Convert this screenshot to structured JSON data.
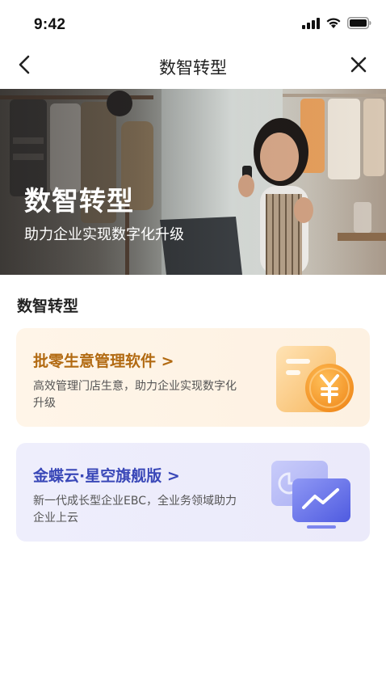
{
  "status_bar": {
    "time": "9:42",
    "icons": [
      "signal-icon",
      "wifi-icon",
      "battery-icon"
    ]
  },
  "nav": {
    "title": "数智转型",
    "back_icon": "chevron-left-icon",
    "close_icon": "close-icon"
  },
  "hero": {
    "title": "数智转型",
    "subtitle": "助力企业实现数字化升级"
  },
  "section": {
    "title": "数智转型"
  },
  "cards": [
    {
      "title": "批零生意管理软件 >",
      "description": "高效管理门店生意，助力企业实现数字化升级",
      "icon": "yen-document-icon",
      "accent": "#b26a12"
    },
    {
      "title": "金蝶云·星空旗舰版 >",
      "description": "新一代成长型企业EBC，全业务领域助力企业上云",
      "icon": "monitor-chart-icon",
      "accent": "#3a48b8"
    }
  ]
}
